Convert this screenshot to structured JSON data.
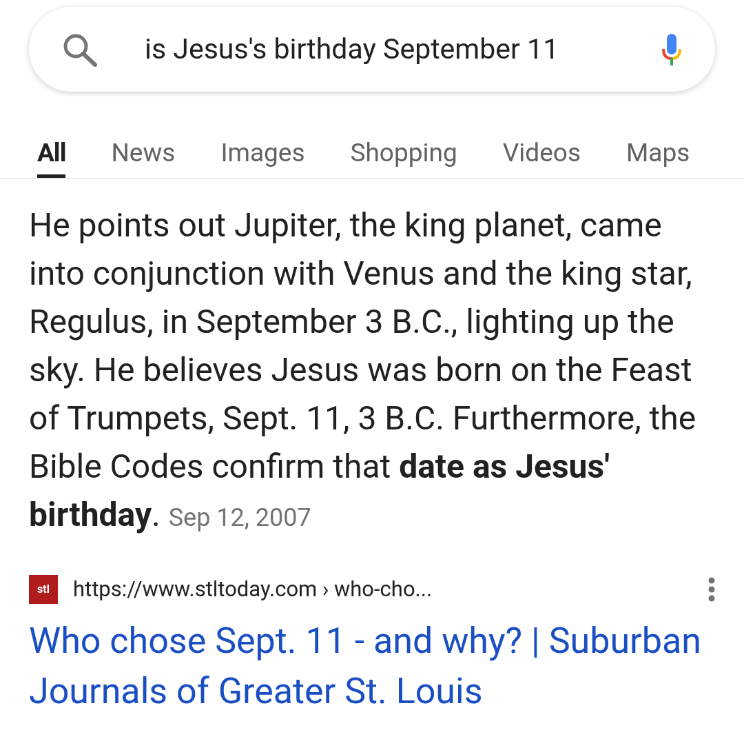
{
  "search": {
    "value": "is Jesus's birthday September 11"
  },
  "tabs": [
    {
      "label": "All",
      "selected": true
    },
    {
      "label": "News",
      "selected": false
    },
    {
      "label": "Images",
      "selected": false
    },
    {
      "label": "Shopping",
      "selected": false
    },
    {
      "label": "Videos",
      "selected": false
    },
    {
      "label": "Maps",
      "selected": false
    }
  ],
  "snippet": {
    "text": "He points out Jupiter, the king planet, came into conjunction with Venus and the king star, Regulus, in September 3 B.C., lighting up the sky. He believes Jesus was born on the Feast of Trumpets, Sept. 11, 3 B.C. Furthermore, the Bible Codes confirm that **date as Jesus' birthday**.",
    "date": "Sep 12, 2007"
  },
  "result": {
    "favicon_text": "stl",
    "url": "https://www.stltoday.com › who-cho...",
    "title": "Who chose Sept. 11 - and why? | Suburban Journals of Greater St. Louis"
  }
}
